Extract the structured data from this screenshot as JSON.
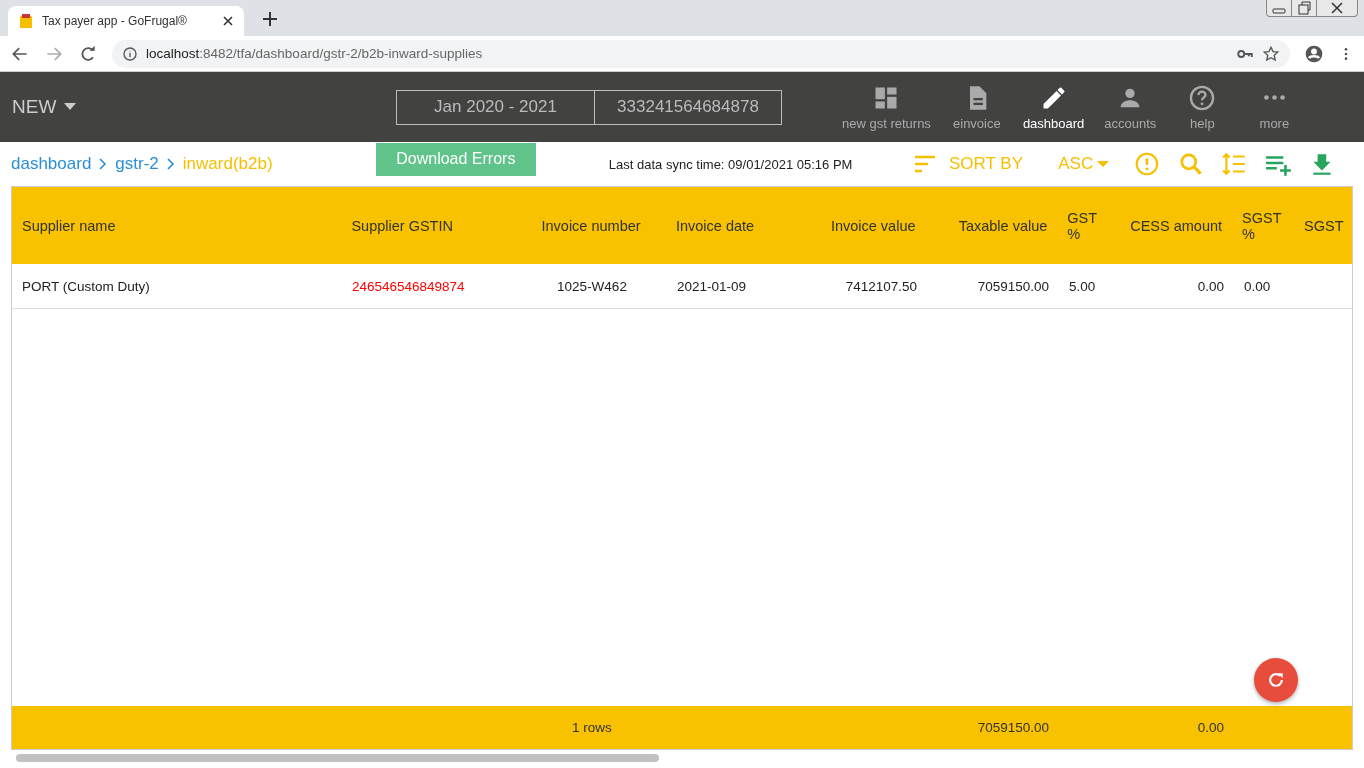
{
  "browser": {
    "tab_title": "Tax payer app - GoFrugal®",
    "url_host": "localhost",
    "url_path": ":8482/tfa/dashboard/gstr-2/b2b-inward-supplies"
  },
  "header": {
    "new_label": "NEW",
    "period": "Jan 2020 - 2021",
    "gstin": "333241564684878",
    "nav": [
      {
        "label": "new gst returns",
        "selected": false
      },
      {
        "label": "einvoice",
        "selected": false
      },
      {
        "label": "dashboard",
        "selected": true
      },
      {
        "label": "accounts",
        "selected": false
      },
      {
        "label": "help",
        "selected": false
      },
      {
        "label": "more",
        "selected": false
      }
    ]
  },
  "breadcrumb": [
    {
      "label": "dashboard",
      "selected": false
    },
    {
      "label": "gstr-2",
      "selected": false
    },
    {
      "label": "inward(b2b)",
      "selected": true
    }
  ],
  "download_button": "Download Errors",
  "sync_text": "Last data sync time: 09/01/2021 05:16 PM",
  "sort_label": "SORT BY",
  "order_label": "ASC",
  "table": {
    "columns": [
      "Supplier name",
      "Supplier GSTIN",
      "Invoice number",
      "Invoice date",
      "Invoice value",
      "Taxable value",
      "GST %",
      "CESS amount",
      "SGST %",
      "SGST"
    ],
    "rows": [
      {
        "cells": [
          "PORT (Custom Duty)",
          "246546546849874",
          "1025-W462",
          "2021-01-09",
          "7412107.50",
          "7059150.00",
          "5.00",
          "0.00",
          "0.00"
        ],
        "gstin_invalid": true
      }
    ],
    "footer": {
      "rows_count": "1 rows",
      "taxable_total": "7059150.00",
      "cess_total": "0.00"
    }
  }
}
